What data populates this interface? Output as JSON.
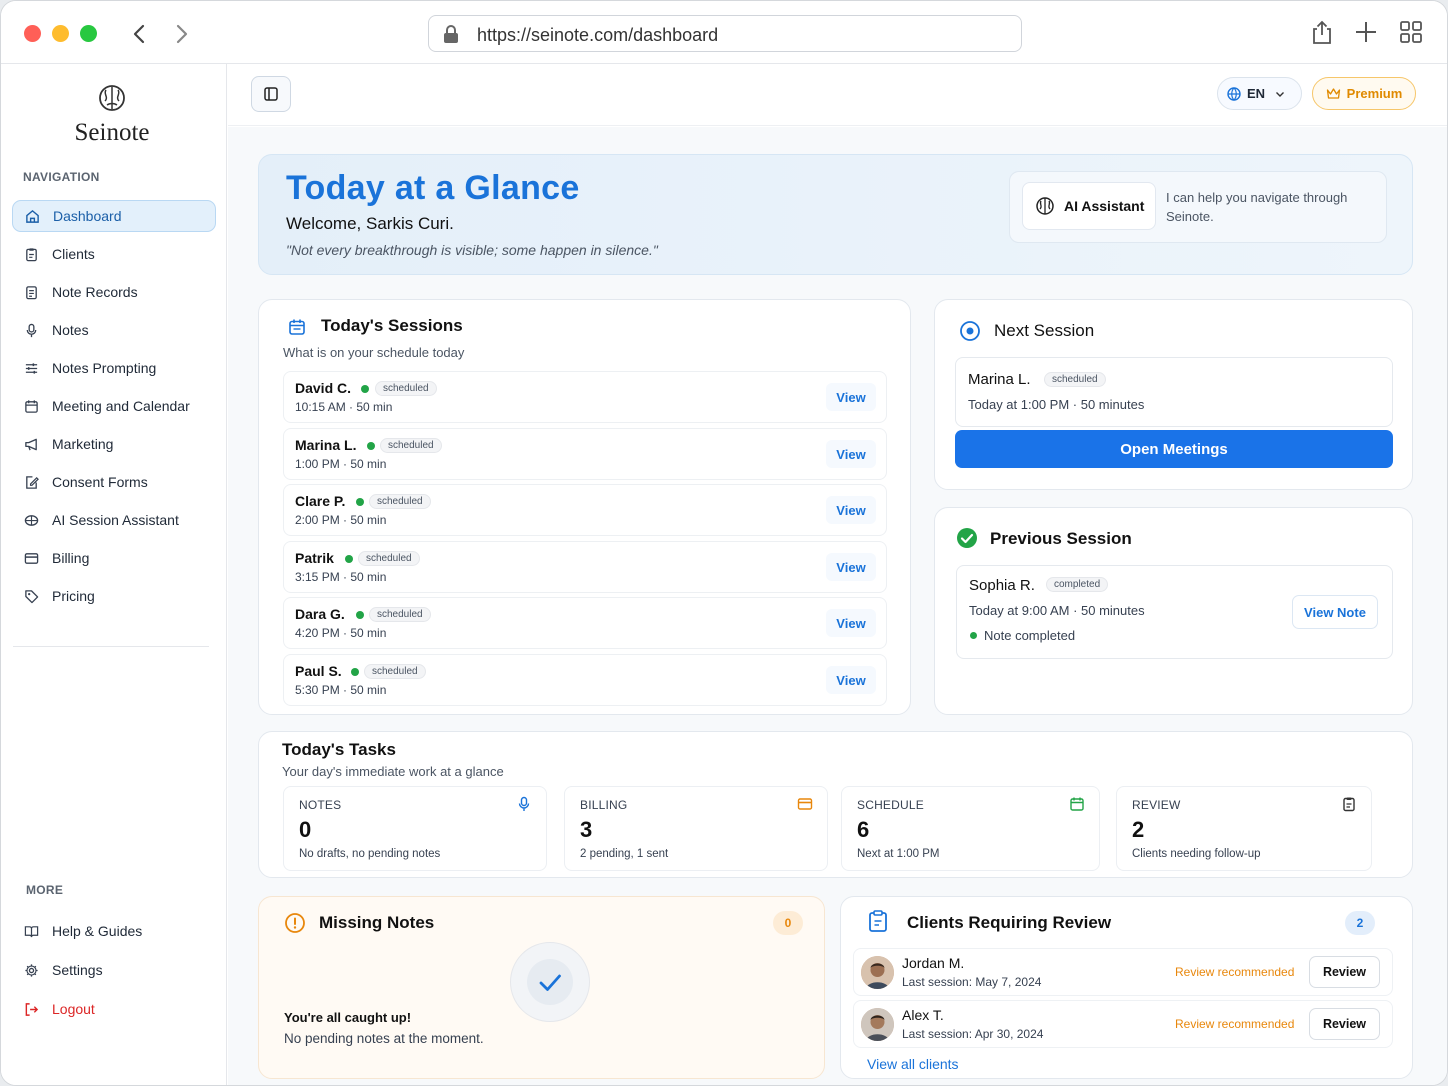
{
  "browser": {
    "url": "https://seinote.com/dashboard"
  },
  "brand": {
    "name": "Seinote"
  },
  "sidebar": {
    "nav_label": "NAVIGATION",
    "items": [
      {
        "label": "Dashboard",
        "icon": "home-icon"
      },
      {
        "label": "Clients",
        "icon": "clipboard-icon"
      },
      {
        "label": "Note Records",
        "icon": "file-icon"
      },
      {
        "label": "Notes",
        "icon": "microphone-icon"
      },
      {
        "label": "Notes Prompting",
        "icon": "sliders-icon"
      },
      {
        "label": "Meeting and Calendar",
        "icon": "calendar-icon"
      },
      {
        "label": "Marketing",
        "icon": "megaphone-icon"
      },
      {
        "label": "Consent Forms",
        "icon": "edit-icon"
      },
      {
        "label": "AI Session Assistant",
        "icon": "brain-icon"
      },
      {
        "label": "Billing",
        "icon": "credit-card-icon"
      },
      {
        "label": "Pricing",
        "icon": "tag-icon"
      }
    ],
    "more_label": "MORE",
    "more_items": [
      {
        "label": "Help & Guides",
        "icon": "book-icon"
      },
      {
        "label": "Settings",
        "icon": "gear-icon"
      },
      {
        "label": "Logout",
        "icon": "logout-icon"
      }
    ]
  },
  "topbar": {
    "lang": "EN",
    "premium": "Premium"
  },
  "hero": {
    "title": "Today at a Glance",
    "welcome": "Welcome, Sarkis Curi.",
    "quote": "\"Not every breakthrough is visible; some happen in silence.\"",
    "ai_button": "AI Assistant",
    "ai_text": "I can help you navigate through Seinote."
  },
  "sessions": {
    "title": "Today's Sessions",
    "subtitle": "What is on your schedule today",
    "view_label": "View",
    "rows": [
      {
        "name": "David C.",
        "status": "scheduled",
        "time": "10:15 AM · 50 min"
      },
      {
        "name": "Marina L.",
        "status": "scheduled",
        "time": "1:00 PM · 50 min"
      },
      {
        "name": "Clare P.",
        "status": "scheduled",
        "time": "2:00 PM · 50 min"
      },
      {
        "name": "Patrik",
        "status": "scheduled",
        "time": "3:15 PM · 50 min"
      },
      {
        "name": "Dara G.",
        "status": "scheduled",
        "time": "4:20 PM · 50 min"
      },
      {
        "name": "Paul S.",
        "status": "scheduled",
        "time": "5:30 PM · 50 min"
      }
    ]
  },
  "next_session": {
    "title": "Next Session",
    "name": "Marina L.",
    "status": "scheduled",
    "detail": "Today at 1:00 PM · 50 minutes",
    "button": "Open Meetings"
  },
  "previous_session": {
    "title": "Previous Session",
    "name": "Sophia R.",
    "status": "completed",
    "detail": "Today at 9:00 AM · 50 minutes",
    "note": "Note completed",
    "button": "View Note"
  },
  "tasks": {
    "title": "Today's Tasks",
    "subtitle": "Your day's immediate work at a glance",
    "items": [
      {
        "label": "NOTES",
        "value": "0",
        "desc": "No drafts, no pending notes",
        "icon": "microphone-icon"
      },
      {
        "label": "BILLING",
        "value": "3",
        "desc": "2 pending, 1 sent",
        "icon": "credit-card-icon"
      },
      {
        "label": "SCHEDULE",
        "value": "6",
        "desc": "Next at 1:00 PM",
        "icon": "calendar-icon"
      },
      {
        "label": "REVIEW",
        "value": "2",
        "desc": "Clients needing follow-up",
        "icon": "clipboard-icon"
      }
    ]
  },
  "missing_notes": {
    "title": "Missing Notes",
    "count": "0",
    "heading": "You're all caught up!",
    "text": "No pending notes at the moment."
  },
  "review": {
    "title": "Clients Requiring Review",
    "count": "2",
    "rows": [
      {
        "name": "Jordan M.",
        "last": "Last session: May 7, 2024",
        "status": "Review recommended",
        "button": "Review"
      },
      {
        "name": "Alex T.",
        "last": "Last session: Apr 30, 2024",
        "status": "Review recommended",
        "button": "Review"
      }
    ],
    "link": "View all clients"
  },
  "colors": {
    "accent": "#1a73e8",
    "success": "#22a447",
    "warning": "#e8870c",
    "danger": "#dc2626"
  }
}
